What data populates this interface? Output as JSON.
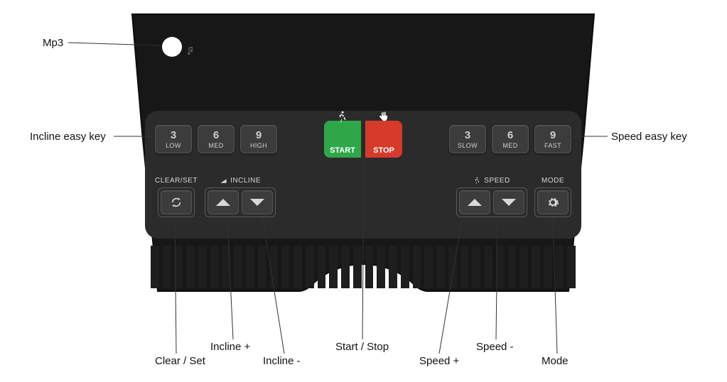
{
  "annotations": {
    "mp3": "Mp3",
    "incline_easy_key": "Incline easy key",
    "speed_easy_key": "Speed easy key",
    "clear_set": "Clear / Set",
    "incline_plus": "Incline +",
    "incline_minus": "Incline -",
    "start_stop": "Start / Stop",
    "speed_plus": "Speed +",
    "speed_minus": "Speed -",
    "mode": "Mode"
  },
  "top_row": {
    "incline_keys": [
      {
        "num": "3",
        "sub": "LOW"
      },
      {
        "num": "6",
        "sub": "MED"
      },
      {
        "num": "9",
        "sub": "HIGH"
      }
    ],
    "start_label": "START",
    "stop_label": "STOP",
    "speed_keys": [
      {
        "num": "3",
        "sub": "SLOW"
      },
      {
        "num": "6",
        "sub": "MED"
      },
      {
        "num": "9",
        "sub": "FAST"
      }
    ]
  },
  "bottom_row": {
    "clear_set_label": "CLEAR/SET",
    "incline_label": "INCLINE",
    "speed_label": "SPEED",
    "mode_label": "MODE"
  },
  "colors": {
    "start": "#2fa749",
    "stop": "#d63a2a",
    "deck": "#2b2b2b",
    "button": "#3c3c3c"
  }
}
